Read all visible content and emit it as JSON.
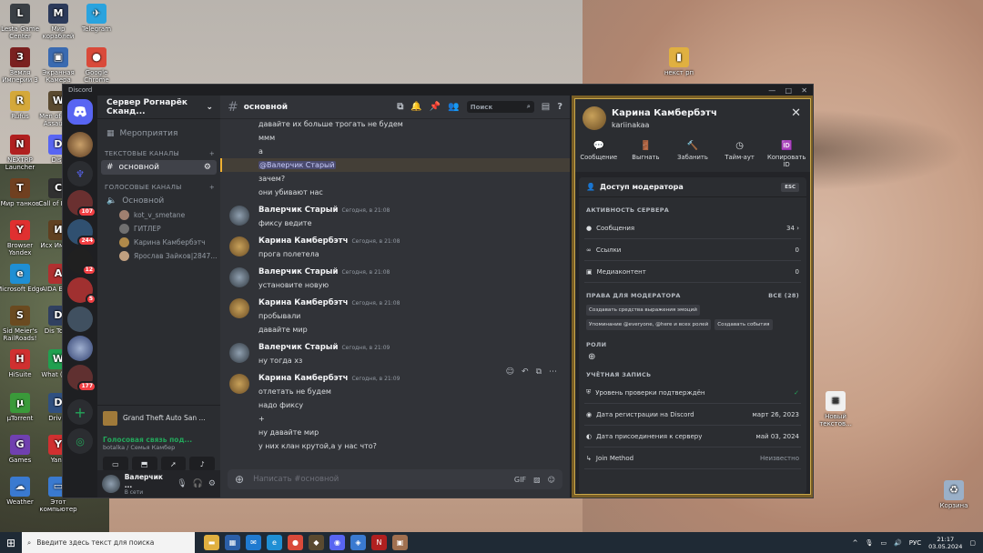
{
  "desktop_icons": [
    {
      "label": "Lesta Game Center",
      "glyph": "L",
      "color": "#3a3f45"
    },
    {
      "label": "Мир кораблей",
      "glyph": "M",
      "color": "#2c3a5a"
    },
    {
      "label": "Telegram",
      "glyph": "✈",
      "color": "#2aa3de"
    },
    {
      "label": "Земля Империи 3",
      "glyph": "З",
      "color": "#7a2020"
    },
    {
      "label": "Экранная Камера",
      "glyph": "▣",
      "color": "#3a6ab0"
    },
    {
      "label": "Google Chrome",
      "glyph": "●",
      "color": "#d94a3a"
    },
    {
      "label": "Rufus",
      "glyph": "R",
      "color": "#d4a83a"
    },
    {
      "label": "Men of War: Assault...",
      "glyph": "W",
      "color": "#5a4a30"
    },
    {
      "label": "NEXTRP Launcher",
      "glyph": "N",
      "color": "#b02020"
    },
    {
      "label": "Disc",
      "glyph": "D",
      "color": "#5865f2"
    },
    {
      "label": "Мир танков",
      "glyph": "T",
      "color": "#704020"
    },
    {
      "label": "Call of Black",
      "glyph": "C",
      "color": "#303030"
    },
    {
      "label": "Browser Yandex",
      "glyph": "Y",
      "color": "#e03030"
    },
    {
      "label": "Исх Импер",
      "glyph": "И",
      "color": "#604020"
    },
    {
      "label": "Microsoft Edge",
      "glyph": "e",
      "color": "#1f8fd4"
    },
    {
      "label": "AIDA Extre",
      "glyph": "A",
      "color": "#b03030"
    },
    {
      "label": "Sid Meier's RailRoads!",
      "glyph": "S",
      "color": "#6a4a20"
    },
    {
      "label": "Dis Tools",
      "glyph": "D",
      "color": "#304060"
    },
    {
      "label": "HiSuite",
      "glyph": "H",
      "color": "#d03030"
    },
    {
      "label": "What (Und",
      "glyph": "W",
      "color": "#20a050"
    },
    {
      "label": "µTorrent",
      "glyph": "µ",
      "color": "#3a9a3a"
    },
    {
      "label": "Driver",
      "glyph": "D",
      "color": "#305080"
    },
    {
      "label": "Games",
      "glyph": "G",
      "color": "#7040b0"
    },
    {
      "label": "Yand",
      "glyph": "Y",
      "color": "#d03030"
    },
    {
      "label": "Weather",
      "glyph": "☁",
      "color": "#3a7ad0"
    },
    {
      "label": "Этот компьютер",
      "glyph": "▭",
      "color": "#3a7ad0"
    },
    {
      "label": "некст рп",
      "glyph": "▮",
      "color": "#e0b040"
    },
    {
      "label": "Новый текстов...",
      "glyph": "≡",
      "color": "#f0f0f0"
    },
    {
      "label": "Корзина",
      "glyph": "♻",
      "color": "#9ab0c8"
    }
  ],
  "discord": {
    "app_title": "Discord",
    "window_controls": [
      "—",
      "□",
      "✕"
    ],
    "guild_badges": [
      "107",
      "244",
      "12",
      "5",
      "177"
    ],
    "server_name": "Сервер Рогнарёк Сканд...",
    "events_label": "Мероприятия",
    "text_category": "ТЕКСТОВЫЕ КАНАЛЫ",
    "text_channel": "основной",
    "voice_category": "ГОЛОСОВЫЕ КАНАЛЫ",
    "voice_channel": "Основной",
    "voice_users": [
      "kot_v_smetane",
      "ГИТЛЕР",
      "Карина Камбербэтч",
      "Ярослав Зайков|2847..."
    ],
    "activity": "Grand Theft Auto San ...",
    "voice_status": "Голосовая связь под...",
    "voice_location": "botalka / Семья Камбер",
    "user_name": "Валерчик ...",
    "user_status": "В сети",
    "channel_title": "основной",
    "search_placeholder": "Поиск",
    "composer_placeholder": "Написать #основной",
    "gif_label": "GIF",
    "early_lines": [
      "давайте их больше трогать не будем",
      "ммм",
      "а"
    ],
    "mention_text": "@Валерчик Старый",
    "after_mention": [
      "зачем?",
      "они убивают нас"
    ],
    "messages": [
      {
        "author": "Валерчик Старый",
        "time": "Сегодня, в 21:08",
        "lines": [
          "фиксу ведите"
        ]
      },
      {
        "author": "Карина Камбербэтч",
        "time": "Сегодня, в 21:08",
        "lines": [
          "прога полетела"
        ]
      },
      {
        "author": "Валерчик Старый",
        "time": "Сегодня, в 21:08",
        "lines": [
          "установите новую"
        ]
      },
      {
        "author": "Карина Камбербэтч",
        "time": "Сегодня, в 21:08",
        "lines": [
          "пробывали",
          "давайте мир"
        ]
      },
      {
        "author": "Валерчик Старый",
        "time": "Сегодня, в 21:09",
        "lines": [
          "ну тогда хз"
        ]
      },
      {
        "author": "Карина Камбербэтч",
        "time": "Сегодня, в 21:09",
        "lines": [
          "отлетать не будем",
          "надо фиксу",
          "+",
          "ну давайте мир",
          "у них клан крутой,а у нас что?"
        ]
      }
    ]
  },
  "profile": {
    "name": "Карина Камбербэтч",
    "handle": "kariinakaa",
    "actions": [
      "Сообщение",
      "Выгнать",
      "Забанить",
      "Тайм-аут",
      "Копировать ID"
    ],
    "header": "Доступ модератора",
    "esc": "ESC",
    "activity_section": "АКТИВНОСТЬ СЕРВЕРА",
    "activity_rows": [
      {
        "label": "Сообщения",
        "value": "34"
      },
      {
        "label": "Ссылки",
        "value": "0"
      },
      {
        "label": "Медиаконтент",
        "value": "0"
      }
    ],
    "perm_section": "ПРАВА ДЛЯ МОДЕРАТОРА",
    "perm_all": "ВСЕ (28)",
    "perms": [
      "Создавать средства выражения эмоций",
      "Упоминание @everyone, @here и всех ролей",
      "Создавать события"
    ],
    "roles_section": "РОЛИ",
    "account_section": "УЧЁТНАЯ ЗАПИСЬ",
    "account_rows": [
      {
        "label": "Уровень проверки подтверждён",
        "value": "✓"
      },
      {
        "label": "Дата регистрации на Discord",
        "value": "март 26, 2023"
      },
      {
        "label": "Дата присоединения к серверу",
        "value": "май 03, 2024"
      },
      {
        "label": "Join Method",
        "value": "Неизвестно"
      }
    ]
  },
  "taskbar": {
    "search_placeholder": "Введите здесь текст для поиска",
    "lang": "РУС",
    "time": "21:17",
    "date": "03.05.2024"
  }
}
